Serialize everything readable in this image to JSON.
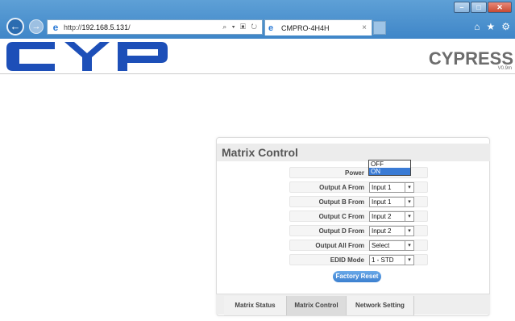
{
  "browser": {
    "url_prefix": "http://",
    "url_host": "192.168.5.131",
    "url_suffix": "/",
    "address_icons": "⌕ ▾ ▣ ↻",
    "tab_title": "CMPRO-4H4H",
    "tab_close": "×",
    "window_controls": [
      "–",
      "□",
      "✕"
    ],
    "toolbar_icons": [
      "home-icon",
      "star-icon",
      "gear-icon"
    ]
  },
  "header": {
    "logo_text": "CYP",
    "brand": "CYPRESS",
    "version": "V0.9m"
  },
  "matrix": {
    "title": "Matrix Control",
    "power_label": "Power",
    "power_options": [
      "OFF",
      "ON"
    ],
    "power_selected": "ON",
    "rows": [
      {
        "label": "Output A From",
        "value": "Input 1"
      },
      {
        "label": "Output B From",
        "value": "Input 1"
      },
      {
        "label": "Output C From",
        "value": "Input 2"
      },
      {
        "label": "Output D From",
        "value": "Input 2"
      },
      {
        "label": "Output All From",
        "value": "Select"
      },
      {
        "label": "EDID Mode",
        "value": "1 - STD"
      }
    ],
    "reset_label": "Factory Reset"
  },
  "tabs": [
    {
      "label": "Matrix Status"
    },
    {
      "label": "Matrix Control"
    },
    {
      "label": "Network Setting"
    }
  ],
  "colors": {
    "accent": "#3b7fd0",
    "chrome": "#4a8fcf",
    "logo_blue": "#1d4fb8"
  }
}
